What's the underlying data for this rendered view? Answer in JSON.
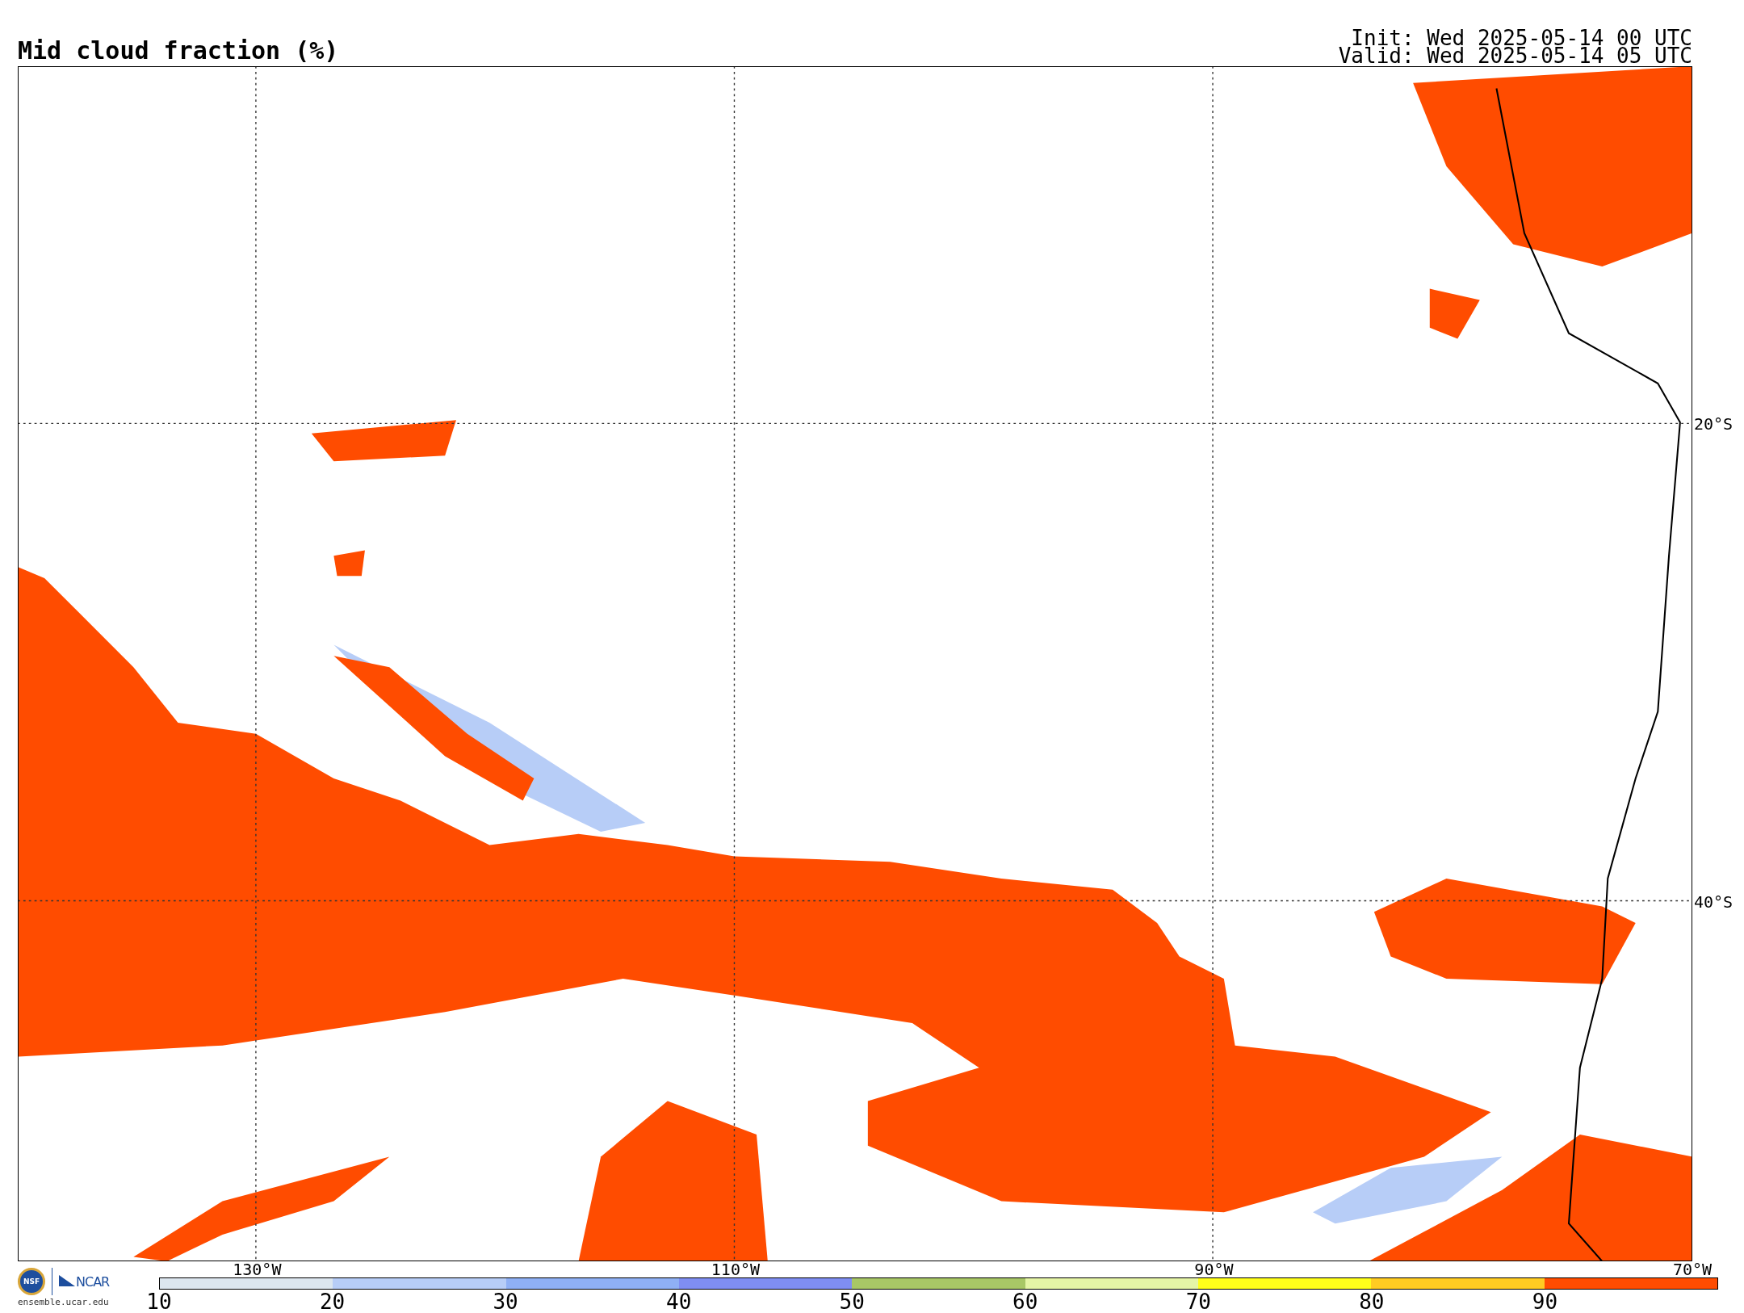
{
  "title": "Mid cloud fraction (%)",
  "timestamps": [
    "Init: Wed 2025-05-14 00 UTC",
    "Valid: Wed 2025-05-14 05 UTC"
  ],
  "map": {
    "longitude_labels": [
      "130°W",
      "110°W",
      "90°W",
      "70°W"
    ],
    "latitude_labels": [
      "20°S",
      "40°S"
    ]
  },
  "colorbar": {
    "bins": [
      {
        "color": "#dce6ef"
      },
      {
        "color": "#b7cdf7"
      },
      {
        "color": "#8fb0f5"
      },
      {
        "color": "#7f8ef2"
      },
      {
        "color": "#a8c766"
      },
      {
        "color": "#e5f5a6"
      },
      {
        "color": "#ffff1a"
      },
      {
        "color": "#ffcc22"
      },
      {
        "color": "#ff4c00"
      }
    ],
    "tick_labels": [
      "10",
      "20",
      "30",
      "40",
      "50",
      "60",
      "70",
      "80",
      "90"
    ]
  },
  "logos": {
    "seal": "NSF",
    "brand": "NCAR",
    "site": "ensemble.ucar.edu"
  }
}
